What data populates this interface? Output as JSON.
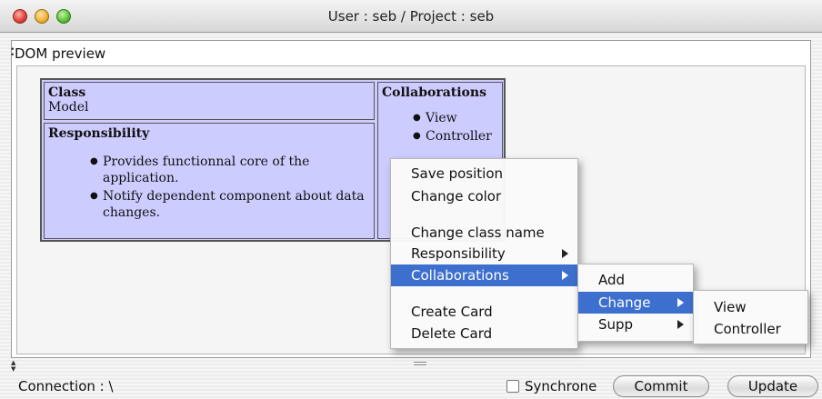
{
  "window": {
    "title": "User : seb / Project : seb"
  },
  "pane": {
    "label": "DOM preview"
  },
  "card": {
    "class_header": "Class",
    "class_name": "Model",
    "responsibility_header": "Responsibility",
    "responsibilities": [
      "Provides functionnal core of the application.",
      "Notify dependent component about data changes."
    ],
    "collaborations_header": "Collaborations",
    "collaborations": [
      "View",
      "Controller"
    ]
  },
  "context_menu": {
    "items": [
      {
        "label": "Save position"
      },
      {
        "label": "Change color"
      },
      {
        "label": "Change class name"
      },
      {
        "label": "Responsibility",
        "submenu": true
      },
      {
        "label": "Collaborations",
        "submenu": true,
        "selected": true
      },
      {
        "label": "Create Card"
      },
      {
        "label": "Delete Card"
      }
    ]
  },
  "collab_submenu": {
    "items": [
      {
        "label": "Add"
      },
      {
        "label": "Change",
        "submenu": true,
        "selected": true
      },
      {
        "label": "Supp",
        "submenu": true
      }
    ]
  },
  "change_submenu": {
    "items": [
      {
        "label": "View"
      },
      {
        "label": "Controller"
      }
    ]
  },
  "footer": {
    "status": "Connection : \\",
    "synchrone_label": "Synchrone",
    "synchrone_checked": false,
    "commit_label": "Commit",
    "update_label": "Update"
  },
  "colors": {
    "card_fill": "#ccccff",
    "menu_highlight": "#3d6fcf"
  }
}
